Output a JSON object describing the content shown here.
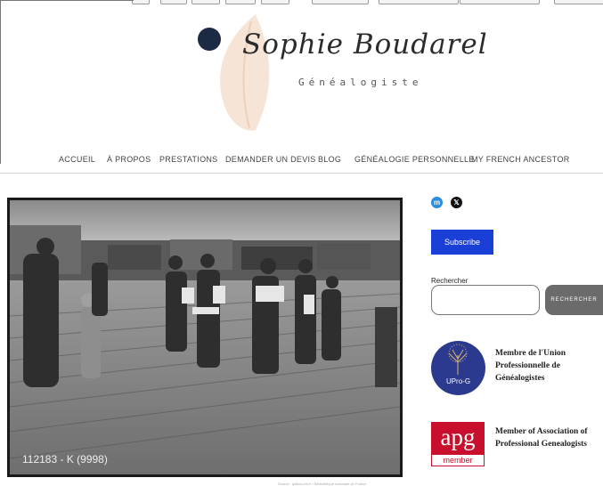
{
  "site": {
    "name": "Sophie Boudarel",
    "tagline": "Généalogiste"
  },
  "nav": {
    "items": [
      "ACCUEIL",
      "À PROPOS",
      "PRESTATIONS",
      "DEMANDER UN DEVIS",
      "BLOG",
      "GÉNÉALOGIE PERSONNELLE",
      "MY FRENCH ANCESTOR"
    ]
  },
  "photo": {
    "caption_code": "112183 - K (9998)",
    "credit": "Source : gallica.bnf.fr / Bibliothèque nationale de France"
  },
  "social": {
    "icons": [
      "mastodon-icon",
      "x-icon"
    ]
  },
  "sidebar": {
    "subscribe_label": "Subscribe",
    "search_label": "Rechercher",
    "search_value": "",
    "search_button": "RECHERCHER",
    "upro": {
      "badge_text": "UPro-G",
      "description": "Membre de l'Union Professionnelle de Généalogistes"
    },
    "apg": {
      "logo_top": "apg",
      "logo_bottom": "member",
      "description": "Member of Association of Professional Genealogists"
    }
  },
  "colors": {
    "accent_blue": "#1a3fd6",
    "search_button": "#6b6b6b",
    "upro_badge": "#2b3a8e",
    "apg_red": "#c8102e",
    "logo_dot": "#1d2a44",
    "logo_leaf": "#f3dcc8"
  }
}
